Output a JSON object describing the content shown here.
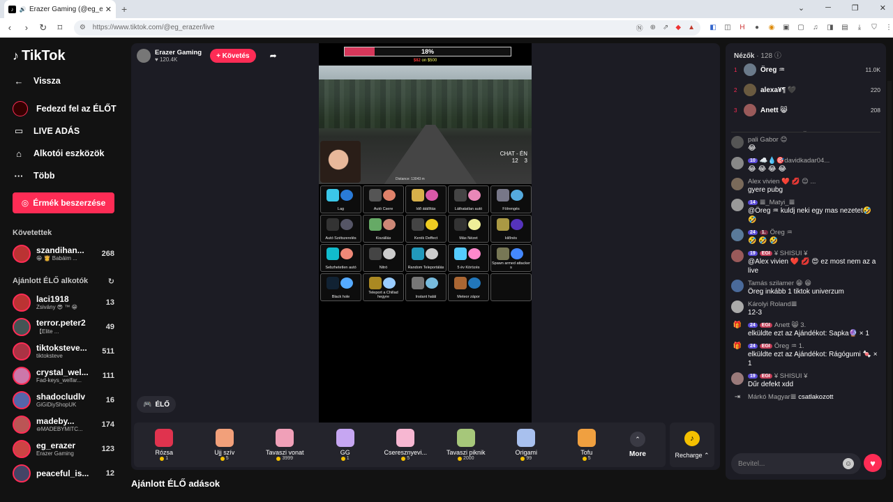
{
  "browser": {
    "tab_title": "Erazer Gaming (@eg_erazer) |",
    "url": "https://www.tiktok.com/@eg_erazer/live"
  },
  "sidebar": {
    "logo": "TikTok",
    "back": "Vissza",
    "nav": [
      {
        "label": "Fedezd fel az ÉLŐT",
        "icon": "live-avatar-icon"
      },
      {
        "label": "LIVE ADÁS",
        "icon": "camera-icon"
      },
      {
        "label": "Alkotói eszközök",
        "icon": "tools-icon"
      },
      {
        "label": "Több",
        "icon": "more-icon"
      }
    ],
    "coins_button": "Érmék beszerzése",
    "following_title": "Követettek",
    "following": [
      {
        "name": "szandihan...",
        "sub": "😁 👸 Babáim ...",
        "count": "268"
      }
    ],
    "recommended_title": "Ajánlott ÉLŐ alkotók",
    "recommended": [
      {
        "name": "laci1918",
        "sub": "Zsivány 😎 ™ 😁",
        "count": "13"
      },
      {
        "name": "terror.peter2",
        "sub": "【Elite ...",
        "count": "49"
      },
      {
        "name": "tiktoksteve...",
        "sub": "tiktoksteve",
        "count": "511"
      },
      {
        "name": "crystal_wel...",
        "sub": "Fad-keys_welfar...",
        "count": "111"
      },
      {
        "name": "shadocludlv",
        "sub": "GiGiDiyShopUK",
        "count": "16"
      },
      {
        "name": "madeby...",
        "sub": "⊖MADEBYMITC...",
        "count": "174"
      },
      {
        "name": "eg_erazer",
        "sub": "Erazer Gaming",
        "count": "123"
      },
      {
        "name": "peaceful_is...",
        "sub": "",
        "count": "12"
      }
    ]
  },
  "host": {
    "name": "Erazer Gaming",
    "likes": "120.4K",
    "follow": "+ Követés"
  },
  "stream": {
    "progress_label": "18%",
    "progress_value": 0.18,
    "goal_prefix": "$82",
    "goal_text": "on $500",
    "chat_en": "CHAT - ÉN",
    "score_a": "12",
    "score_b": "3",
    "distance": "Distance: 13043 m",
    "grid": [
      {
        "label": "Lag",
        "c1": "#3bc7e8",
        "c2": "#2a7bd8"
      },
      {
        "label": "Autó Csere",
        "c1": "#555",
        "c2": "#e0826a"
      },
      {
        "label": "Idő átállítás",
        "c1": "#d7b04a",
        "c2": "#d858a8"
      },
      {
        "label": "Láthatatlan autó",
        "c1": "#444",
        "c2": "#e888b8"
      },
      {
        "label": "Fölrengés",
        "c1": "#778",
        "c2": "#5ad"
      },
      {
        "label": "Autó Szétszerelés",
        "c1": "#333",
        "c2": "#556"
      },
      {
        "label": "Kiszállás",
        "c1": "#6a6",
        "c2": "#c87"
      },
      {
        "label": "Kerék Deffect",
        "c1": "#444",
        "c2": "#eecc22"
      },
      {
        "label": "Más Nézet",
        "c1": "#333",
        "c2": "#ee9"
      },
      {
        "label": "kilőnés",
        "c1": "#aa9944",
        "c2": "#5533bb"
      },
      {
        "label": "Sebzhetetlen autó",
        "c1": "#1bc",
        "c2": "#e87"
      },
      {
        "label": "Nitró",
        "c1": "#444",
        "c2": "#ccc"
      },
      {
        "label": "Random Teleportálás",
        "c1": "#29b",
        "c2": "#ccc"
      },
      {
        "label": "5 év Körözés",
        "c1": "#5cf",
        "c2": "#f8c"
      },
      {
        "label": "Spawn armed attacker s",
        "c1": "#775",
        "c2": "#48f"
      },
      {
        "label": "Black hole",
        "c1": "#123",
        "c2": "#5af"
      },
      {
        "label": "Teleport a Chillad hegyre",
        "c1": "#a82",
        "c2": "#9cf"
      },
      {
        "label": "Instant halál",
        "c1": "#777",
        "c2": "#7bd"
      },
      {
        "label": "Meteor zápor",
        "c1": "#a63",
        "c2": "#27b"
      },
      {
        "label": "",
        "c1": "#0d0d0d",
        "c2": "#0d0d0d"
      }
    ],
    "live_chip": "ÉLŐ"
  },
  "gifts": [
    {
      "name": "Rózsa",
      "price": "1",
      "color": "#e0334e"
    },
    {
      "name": "Ujj szív",
      "price": "5",
      "color": "#f2a07a"
    },
    {
      "name": "Tavaszi vonat",
      "price": "3999",
      "color": "#f0a0b8"
    },
    {
      "name": "GG",
      "price": "1",
      "color": "#c6a6f2"
    },
    {
      "name": "Cseresznyevi...",
      "price": "5",
      "color": "#f7b7d2"
    },
    {
      "name": "Tavaszi piknik",
      "price": "2000",
      "color": "#a6c77a"
    },
    {
      "name": "Origami",
      "price": "99",
      "color": "#a8c0ee"
    },
    {
      "name": "Tofu",
      "price": "5",
      "color": "#f0a040"
    }
  ],
  "more_label": "More",
  "recharge_label": "Recharge",
  "recommended_live_title": "Ajánlott ÉLŐ adások",
  "chat": {
    "viewers_label": "Nézők",
    "viewers_count": "· 128",
    "top_viewers": [
      {
        "rank": "1",
        "name": "Öreg ♒",
        "score": "11.0K"
      },
      {
        "rank": "2",
        "name": "alexa¥¶ 🖤",
        "score": "220"
      },
      {
        "rank": "3",
        "name": "Anett 😸",
        "score": "208"
      }
    ],
    "messages": [
      {
        "type": "msg",
        "badge": "",
        "badge2": "",
        "name": "pali Gabor 😊",
        "text": "😂"
      },
      {
        "type": "msg",
        "badge": "10",
        "badge2": "",
        "name": "☁️💧🎯davidkadar04...",
        "text": "😂 😂 😂 😂"
      },
      {
        "type": "msg",
        "badge": "",
        "badge2": "",
        "name": "Alex vivien ❤️ 💋 😊 ...",
        "text": "gyere pubg"
      },
      {
        "type": "msg",
        "badge": "14",
        "badge2": "",
        "name": "𝌆_Matyi_𝌆",
        "text": "@Öreg ♒ kuldj neki egy mas nezetet🤣 🤣"
      },
      {
        "type": "msg",
        "badge": "24",
        "badge2": "1.",
        "name": "Öreg ♒",
        "text": "🤣 🤣 🤣"
      },
      {
        "type": "msg",
        "badge": "19",
        "badge2": "EGI",
        "name": "¥ SHISUI ¥",
        "text": "@Alex vivien ❤️ 💋 😍 ez most nem az a live"
      },
      {
        "type": "msg",
        "badge": "",
        "badge2": "",
        "name": "Tamás szilamer 😁 😁",
        "text": "Öreg inkább 1 tiktok univerzum"
      },
      {
        "type": "msg",
        "badge": "",
        "badge2": "",
        "name": "Károlyi Roland𝌆",
        "text": "12-3"
      },
      {
        "type": "gift",
        "badge": "24",
        "badge2": "EGI",
        "name": "Anett 😸 3.",
        "text": "elküldte ezt az Ajándékot: Sapka🔮 × 1"
      },
      {
        "type": "gift",
        "badge": "24",
        "badge2": "EGI",
        "name": "Öreg ♒ 1.",
        "text": "elküldte ezt az Ajándékot: Rágógumi 🍬 × 1"
      },
      {
        "type": "msg",
        "badge": "19",
        "badge2": "EGI",
        "name": "¥ SHISUI ¥",
        "text": "Dűr defekt xdd"
      },
      {
        "type": "join",
        "badge": "",
        "badge2": "",
        "name": "Márkó Magyar𝌆",
        "text": "csatlakozott"
      }
    ],
    "input_placeholder": "Bevitel..."
  }
}
